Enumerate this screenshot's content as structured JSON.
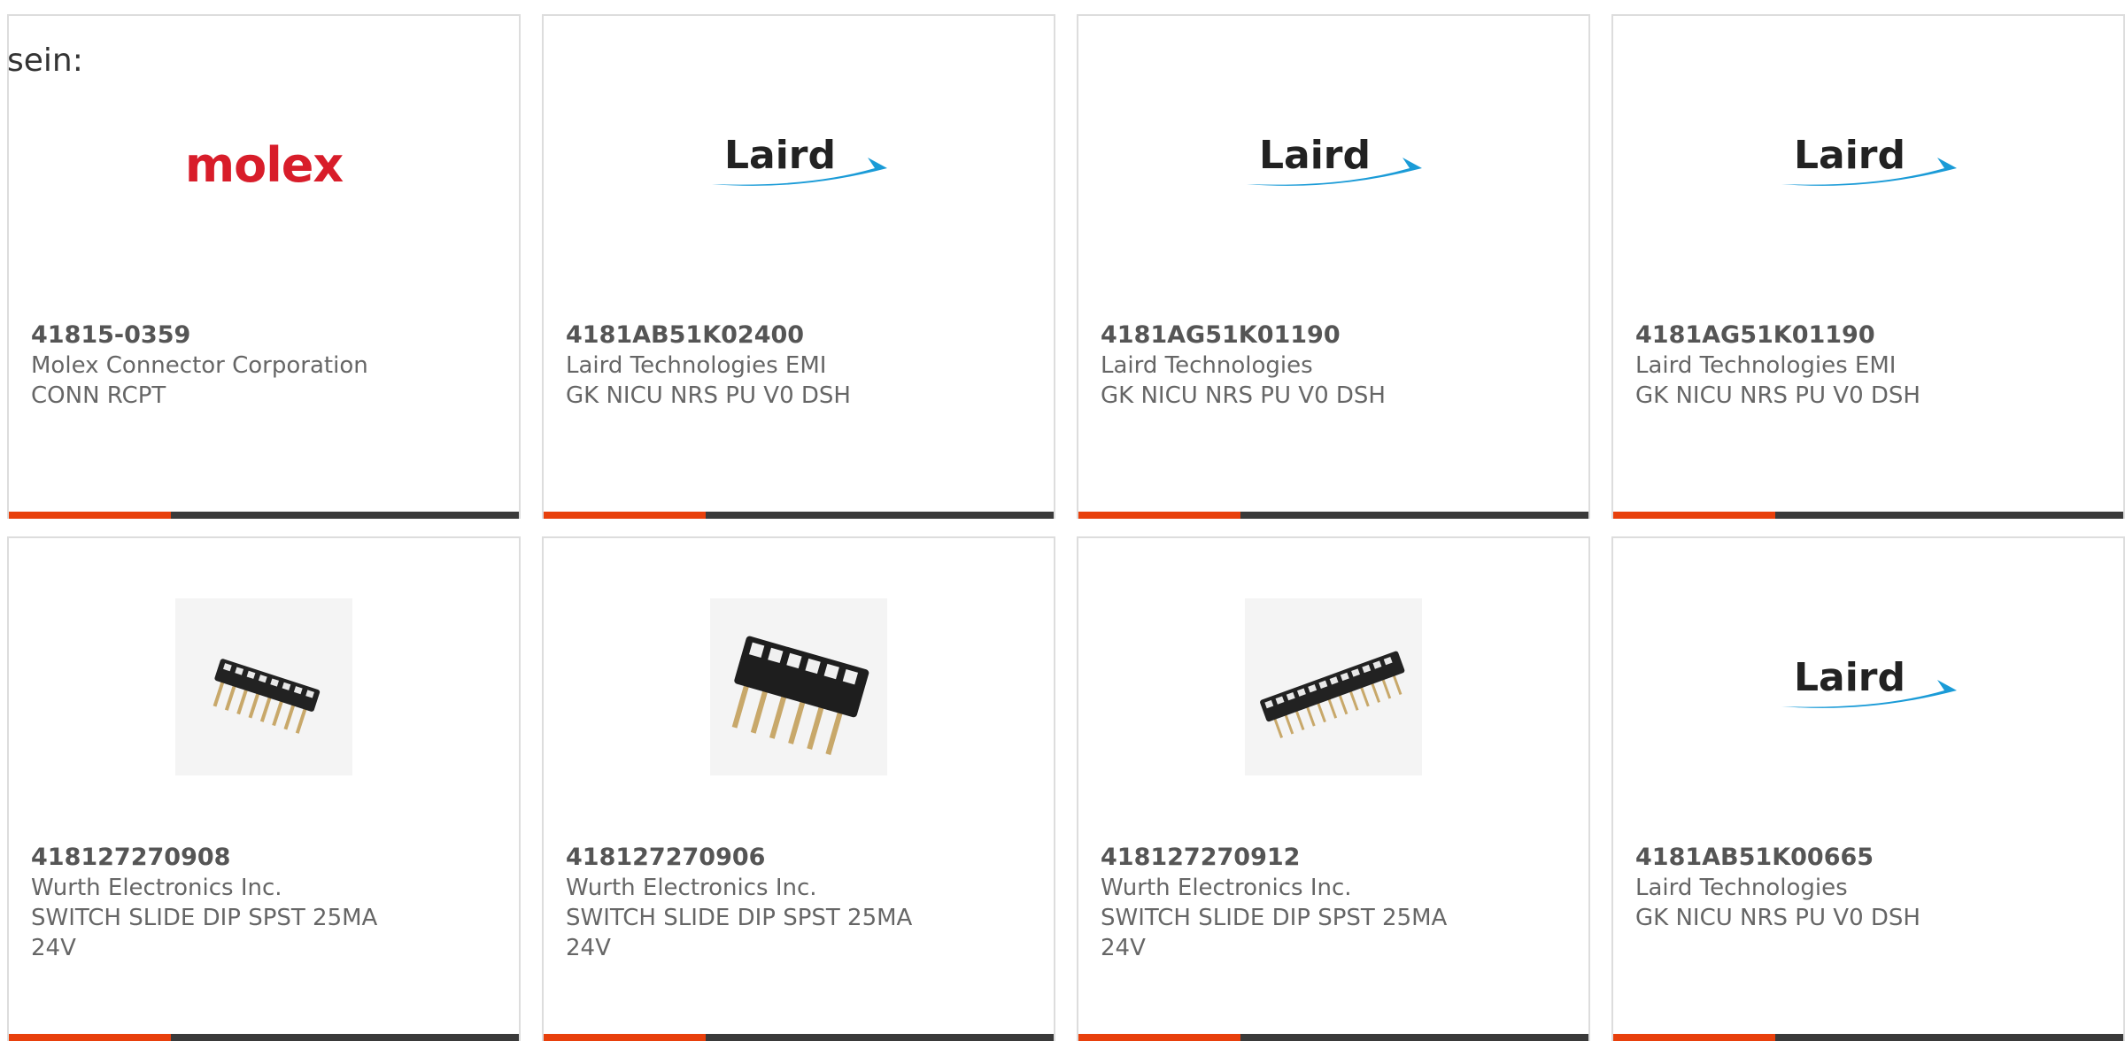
{
  "intro_text": "sein:",
  "colors": {
    "accent": "#e8400c",
    "bar": "#3a3a3a",
    "border": "#dddddd",
    "molex": "#d81d2a",
    "laird_swoosh": "#1a9bd7"
  },
  "cards": [
    {
      "part_number": "41815-0359",
      "manufacturer": "Molex Connector Corporation",
      "description": "CONN RCPT",
      "image": "molex-logo",
      "logo_text": "molex"
    },
    {
      "part_number": "4181AB51K02400",
      "manufacturer": "Laird Technologies EMI",
      "description": "GK NICU NRS PU V0 DSH",
      "image": "laird-logo",
      "logo_text": "Laird"
    },
    {
      "part_number": "4181AG51K01190",
      "manufacturer": "Laird Technologies",
      "description": "GK NICU NRS PU V0 DSH",
      "image": "laird-logo",
      "logo_text": "Laird"
    },
    {
      "part_number": "4181AG51K01190",
      "manufacturer": "Laird Technologies EMI",
      "description": "GK NICU NRS PU V0 DSH",
      "image": "laird-logo",
      "logo_text": "Laird"
    },
    {
      "part_number": "418127270908",
      "manufacturer": "Wurth Electronics Inc.",
      "description": "SWITCH SLIDE DIP SPST 25MA 24V",
      "image": "dip-switch-8"
    },
    {
      "part_number": "418127270906",
      "manufacturer": "Wurth Electronics Inc.",
      "description": "SWITCH SLIDE DIP SPST 25MA 24V",
      "image": "dip-switch-6"
    },
    {
      "part_number": "418127270912",
      "manufacturer": "Wurth Electronics Inc.",
      "description": "SWITCH SLIDE DIP SPST 25MA 24V",
      "image": "dip-switch-12"
    },
    {
      "part_number": "4181AB51K00665",
      "manufacturer": "Laird Technologies",
      "description": "GK NICU NRS PU V0 DSH",
      "image": "laird-logo",
      "logo_text": "Laird"
    }
  ]
}
